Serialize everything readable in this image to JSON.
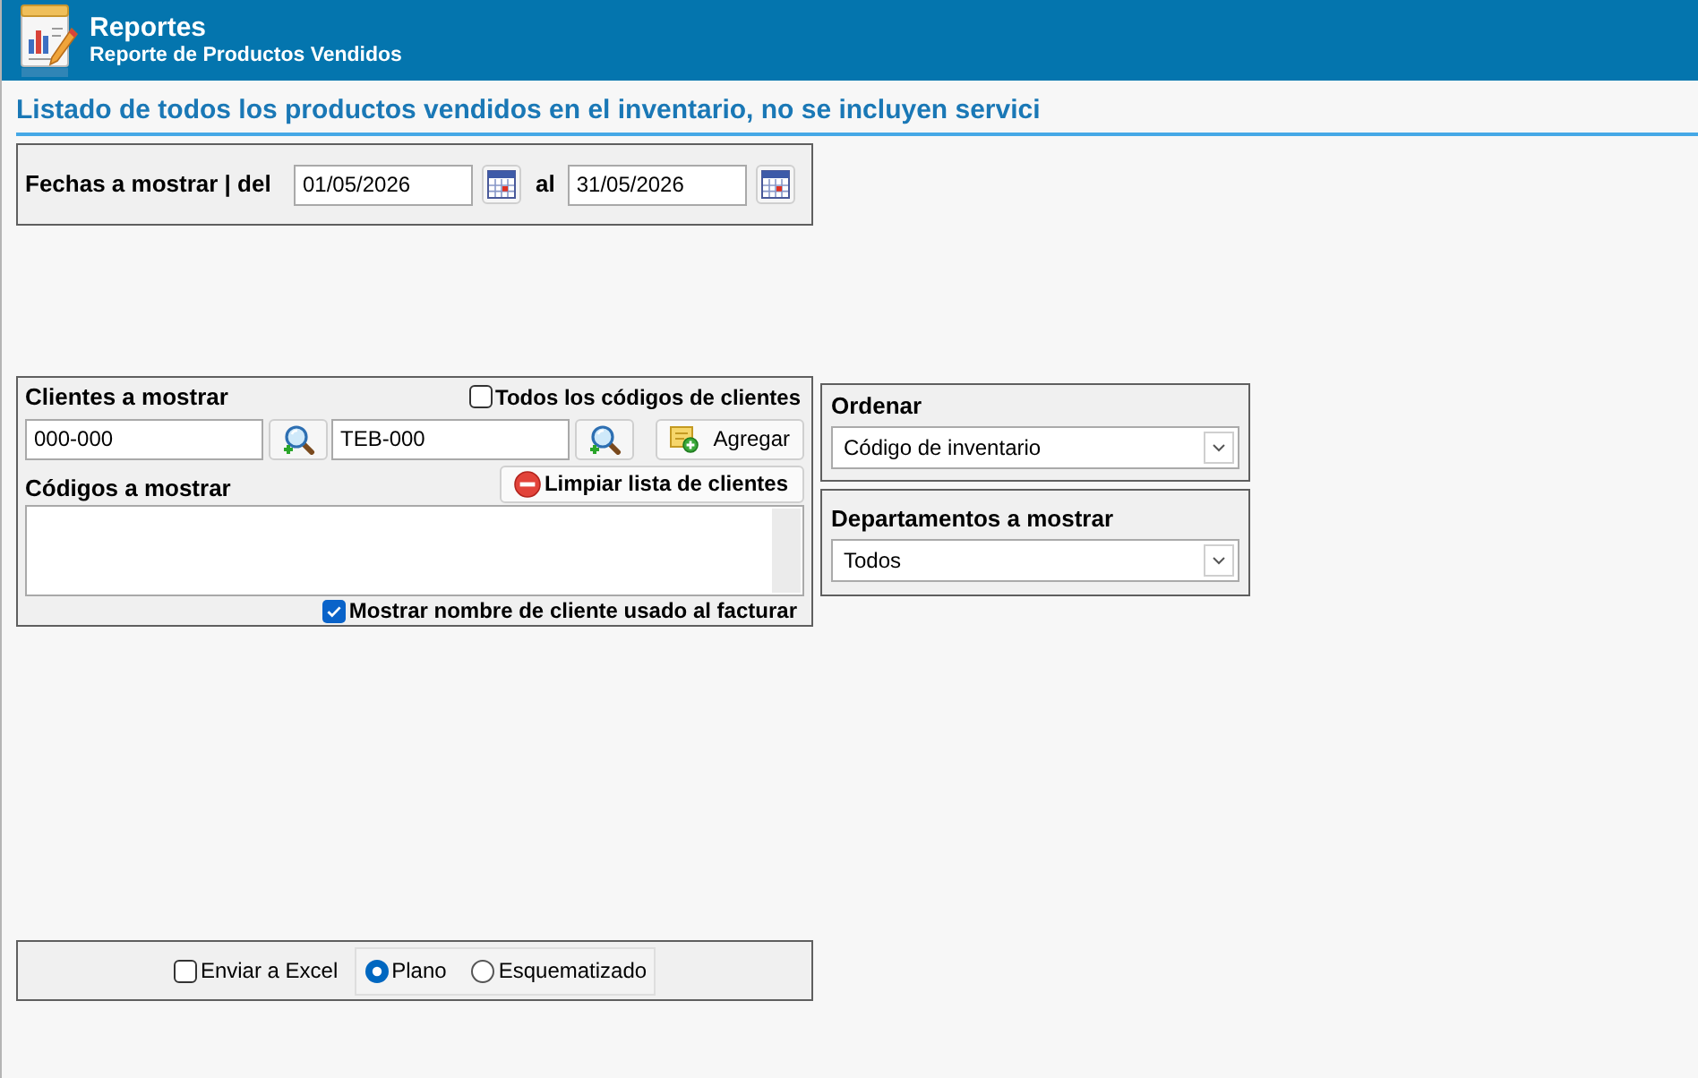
{
  "header": {
    "title": "Reportes",
    "subtitle": "Reporte de Productos Vendidos"
  },
  "heading": "Listado de todos los productos vendidos en el inventario, no se incluyen servici",
  "date_range": {
    "label": "Fechas a mostrar | del",
    "from": "01/05/2026",
    "to_label": "al",
    "to": "31/05/2026"
  },
  "clients": {
    "label": "Clientes a mostrar",
    "all_codes": {
      "label": "Todos los códigos de clientes",
      "checked": false
    },
    "from": "000-000",
    "to": "TEB-000",
    "add_button": "Agregar",
    "codes_label": "Códigos a mostrar",
    "clear_button": "Limpiar lista de clientes",
    "show_name": {
      "label": "Mostrar nombre de cliente usado al facturar",
      "checked": true
    }
  },
  "sort": {
    "label": "Ordenar",
    "value": "Código de inventario"
  },
  "departments": {
    "label": "Departamentos a mostrar",
    "value": "Todos"
  },
  "export": {
    "excel": {
      "label": "Enviar a Excel",
      "checked": false
    },
    "format": [
      {
        "label": "Plano",
        "selected": true
      },
      {
        "label": "Esquematizado",
        "selected": false
      }
    ]
  }
}
